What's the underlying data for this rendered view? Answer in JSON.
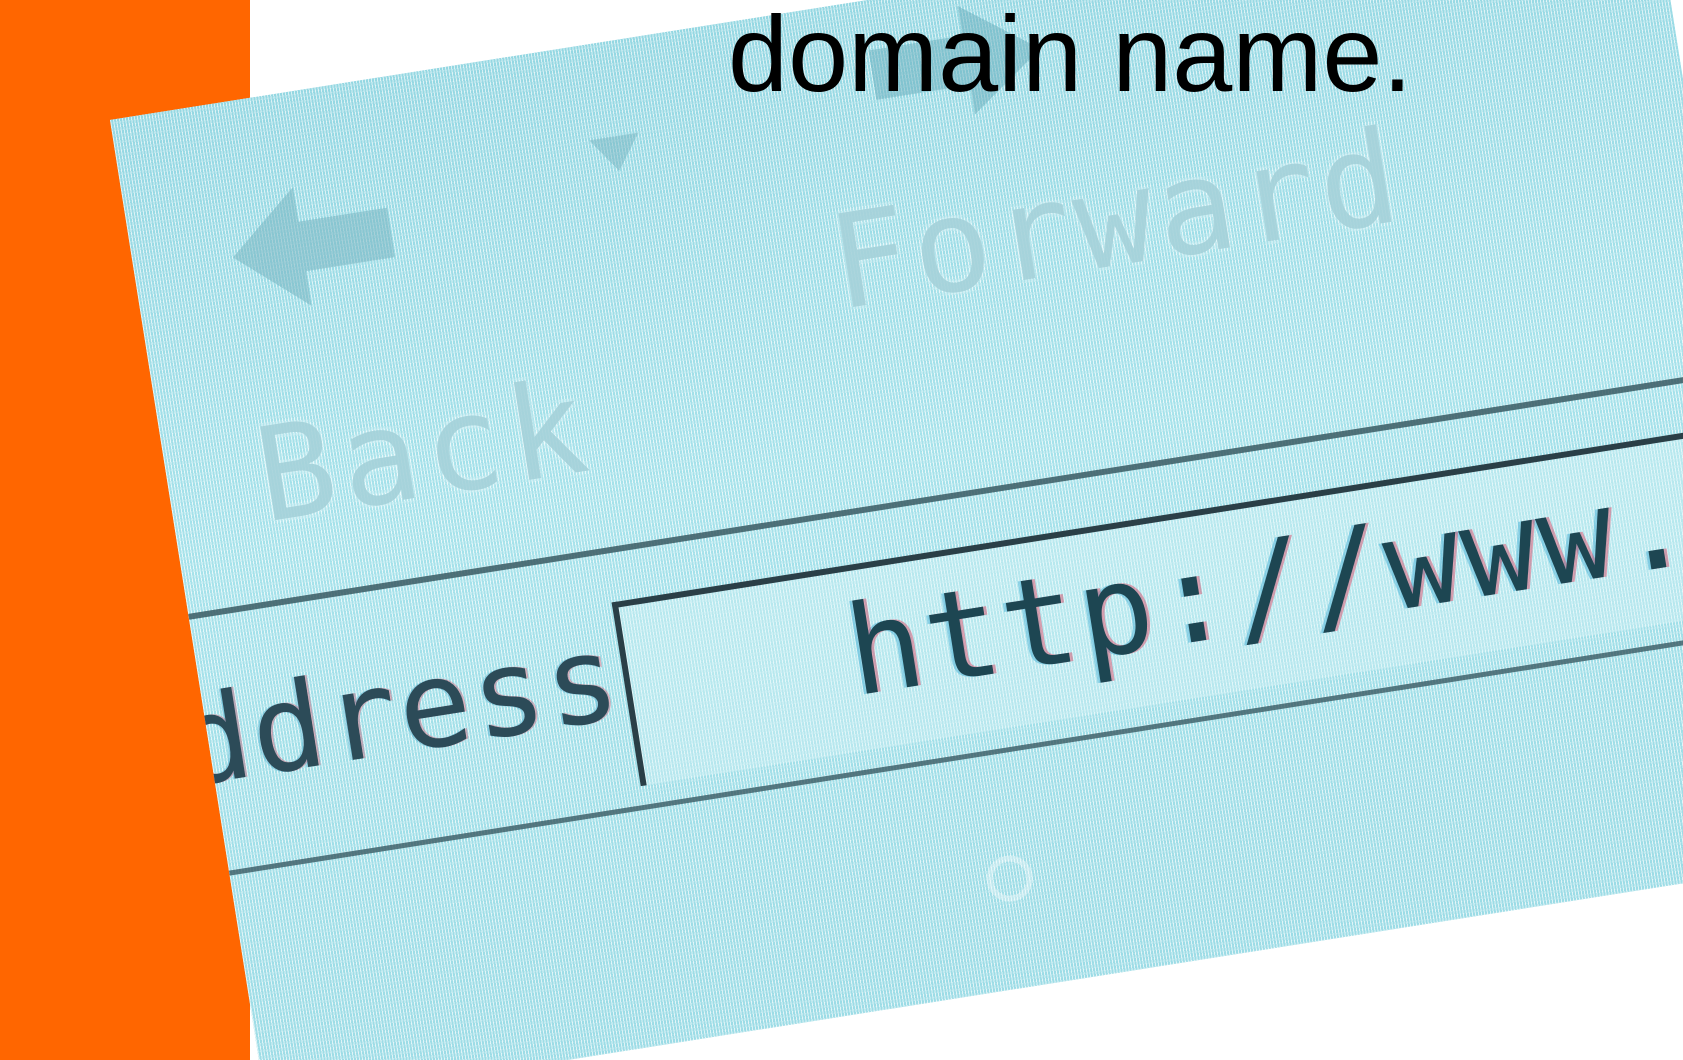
{
  "slide": {
    "caption": "domain name.",
    "accent_color": "#ff6600"
  },
  "browser_photo": {
    "back_label": "Back",
    "forward_label": "Forward",
    "address_label": "ddress",
    "address_value": "http://www...",
    "back_icon": "left-arrow-icon",
    "forward_icon": "right-arrow-icon",
    "dropdown_icon": "chevron-down-icon",
    "tint_color": "#b9e7ee"
  }
}
